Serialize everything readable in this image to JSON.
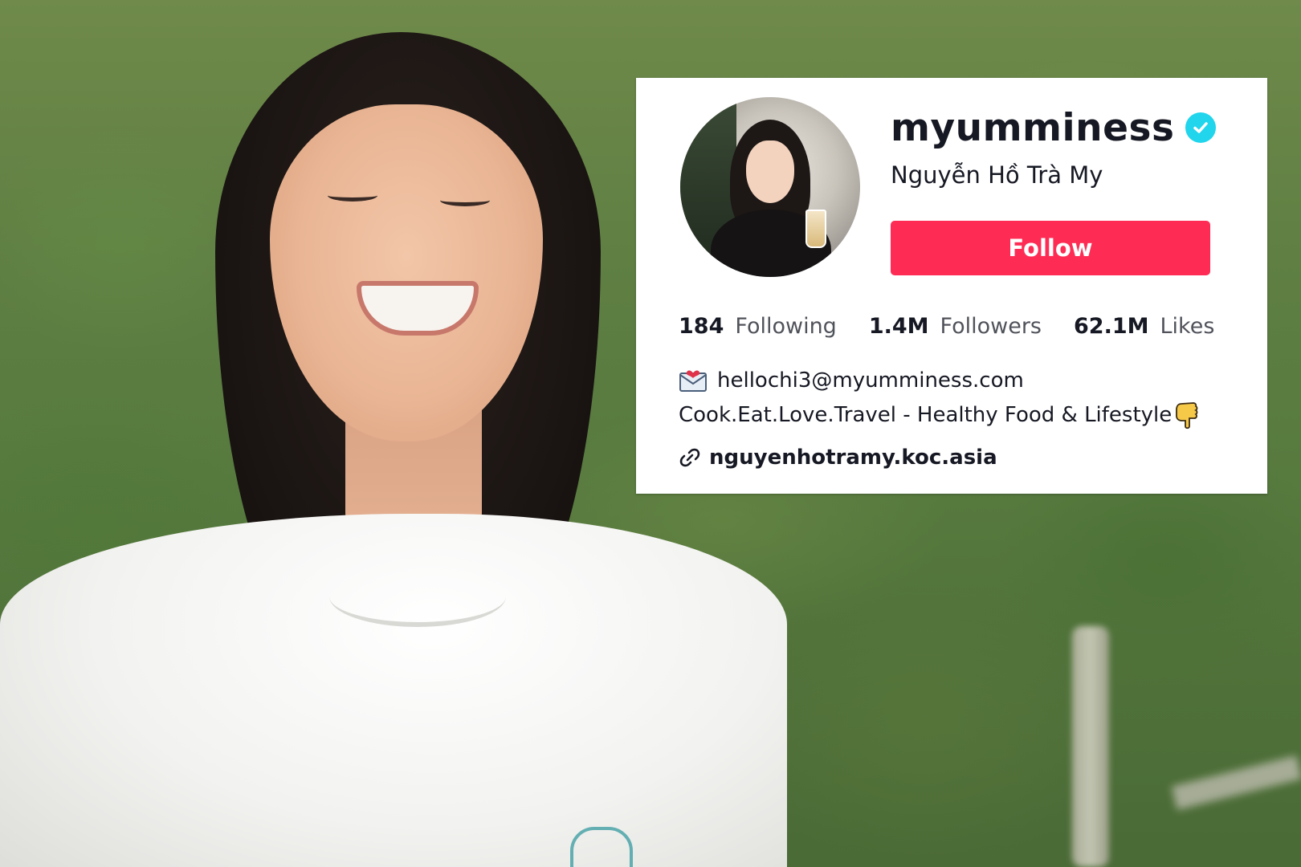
{
  "profile": {
    "username": "myumminess",
    "display_name": "Nguyễn Hồ Trà My",
    "follow_label": "Follow",
    "verified": true,
    "colors": {
      "follow_button": "#fe2c55",
      "verified_badge": "#20d5ec",
      "text_primary": "#161823"
    },
    "stats": [
      {
        "value": "184",
        "label": "Following"
      },
      {
        "value": "1.4M",
        "label": "Followers"
      },
      {
        "value": "62.1M",
        "label": "Likes"
      }
    ],
    "email": "hellochi3@myumminess.com",
    "bio": "Cook.Eat.Love.Travel - Healthy Food & Lifestyle",
    "link": "nguyenhotramy.koc.asia",
    "icons": {
      "verified": "verified-check-icon",
      "email": "love-letter-icon",
      "bio_end": "pointing-down-hand-icon",
      "link": "link-chain-icon"
    }
  }
}
